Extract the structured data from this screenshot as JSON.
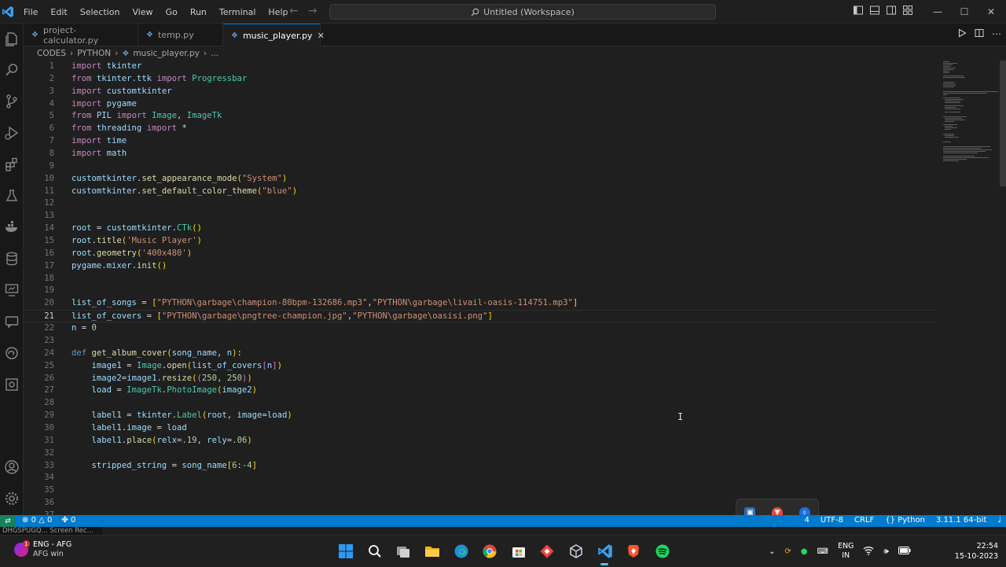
{
  "app": {
    "menu": [
      "File",
      "Edit",
      "Selection",
      "View",
      "Go",
      "Run",
      "Terminal",
      "Help"
    ],
    "search": "Untitled (Workspace)"
  },
  "tabs": [
    {
      "label": "project-calculator.py",
      "active": false
    },
    {
      "label": "temp.py",
      "active": false
    },
    {
      "label": "music_player.py",
      "active": true
    }
  ],
  "breadcrumb": {
    "root": "CODES",
    "folder": "PYTHON",
    "file": "music_player.py",
    "more": "..."
  },
  "editor": {
    "current_line": "21",
    "lines": [
      {
        "n": "1",
        "tokens": [
          [
            "kw",
            "import"
          ],
          [
            "txt",
            " "
          ],
          [
            "var",
            "tkinter"
          ]
        ]
      },
      {
        "n": "2",
        "tokens": [
          [
            "kw",
            "from"
          ],
          [
            "txt",
            " "
          ],
          [
            "var",
            "tkinter.ttk"
          ],
          [
            "txt",
            " "
          ],
          [
            "kw",
            "import"
          ],
          [
            "txt",
            " "
          ],
          [
            "cls",
            "Progressbar"
          ]
        ]
      },
      {
        "n": "3",
        "tokens": [
          [
            "kw",
            "import"
          ],
          [
            "txt",
            " "
          ],
          [
            "var",
            "customtkinter"
          ]
        ]
      },
      {
        "n": "4",
        "tokens": [
          [
            "kw",
            "import"
          ],
          [
            "txt",
            " "
          ],
          [
            "var",
            "pygame"
          ]
        ]
      },
      {
        "n": "5",
        "tokens": [
          [
            "kw",
            "from"
          ],
          [
            "txt",
            " "
          ],
          [
            "var",
            "PIL"
          ],
          [
            "txt",
            " "
          ],
          [
            "kw",
            "import"
          ],
          [
            "txt",
            " "
          ],
          [
            "cls",
            "Image"
          ],
          [
            "txt",
            ", "
          ],
          [
            "cls",
            "ImageTk"
          ]
        ]
      },
      {
        "n": "6",
        "tokens": [
          [
            "kw",
            "from"
          ],
          [
            "txt",
            " "
          ],
          [
            "var",
            "threading"
          ],
          [
            "txt",
            " "
          ],
          [
            "kw",
            "import"
          ],
          [
            "txt",
            " *"
          ]
        ]
      },
      {
        "n": "7",
        "tokens": [
          [
            "kw",
            "import"
          ],
          [
            "txt",
            " "
          ],
          [
            "var",
            "time"
          ]
        ]
      },
      {
        "n": "8",
        "tokens": [
          [
            "kw",
            "import"
          ],
          [
            "txt",
            " "
          ],
          [
            "var",
            "math"
          ]
        ]
      },
      {
        "n": "9",
        "tokens": []
      },
      {
        "n": "10",
        "tokens": [
          [
            "var",
            "customtkinter"
          ],
          [
            "txt",
            "."
          ],
          [
            "fn",
            "set_appearance_mode"
          ],
          [
            "br1",
            "("
          ],
          [
            "str",
            "\"System\""
          ],
          [
            "br1",
            ")"
          ]
        ]
      },
      {
        "n": "11",
        "tokens": [
          [
            "var",
            "customtkinter"
          ],
          [
            "txt",
            "."
          ],
          [
            "fn",
            "set_default_color_theme"
          ],
          [
            "br1",
            "("
          ],
          [
            "str",
            "\"blue\""
          ],
          [
            "br1",
            ")"
          ]
        ]
      },
      {
        "n": "12",
        "tokens": []
      },
      {
        "n": "13",
        "tokens": []
      },
      {
        "n": "14",
        "tokens": [
          [
            "var",
            "root"
          ],
          [
            "txt",
            " = "
          ],
          [
            "var",
            "customtkinter"
          ],
          [
            "txt",
            "."
          ],
          [
            "cls",
            "CTk"
          ],
          [
            "br1",
            "()"
          ]
        ]
      },
      {
        "n": "15",
        "tokens": [
          [
            "var",
            "root"
          ],
          [
            "txt",
            "."
          ],
          [
            "fn",
            "title"
          ],
          [
            "br1",
            "("
          ],
          [
            "str",
            "'Music Player'"
          ],
          [
            "br1",
            ")"
          ]
        ]
      },
      {
        "n": "16",
        "tokens": [
          [
            "var",
            "root"
          ],
          [
            "txt",
            "."
          ],
          [
            "fn",
            "geometry"
          ],
          [
            "br1",
            "("
          ],
          [
            "str",
            "'400x480'"
          ],
          [
            "br1",
            ")"
          ]
        ]
      },
      {
        "n": "17",
        "tokens": [
          [
            "var",
            "pygame"
          ],
          [
            "txt",
            "."
          ],
          [
            "var",
            "mixer"
          ],
          [
            "txt",
            "."
          ],
          [
            "fn",
            "init"
          ],
          [
            "br1",
            "()"
          ]
        ]
      },
      {
        "n": "18",
        "tokens": []
      },
      {
        "n": "19",
        "tokens": []
      },
      {
        "n": "20",
        "tokens": [
          [
            "var",
            "list_of_songs"
          ],
          [
            "txt",
            " = "
          ],
          [
            "br1",
            "["
          ],
          [
            "str",
            "\"PYTHON\\garbage\\champion-80bpm-132686.mp3\""
          ],
          [
            "txt",
            ","
          ],
          [
            "str",
            "\"PYTHON\\garbage\\livail-oasis-114751.mp3\""
          ],
          [
            "br1",
            "]"
          ]
        ]
      },
      {
        "n": "21",
        "tokens": [
          [
            "var",
            "list_of_covers"
          ],
          [
            "txt",
            " = "
          ],
          [
            "br1",
            "["
          ],
          [
            "str",
            "\"PYTHON\\garbage\\pngtree-champion.jpg\""
          ],
          [
            "txt",
            ","
          ],
          [
            "str",
            "\"PYTHON\\garbage\\oasisi.png\""
          ],
          [
            "br1",
            "]"
          ]
        ]
      },
      {
        "n": "22",
        "tokens": [
          [
            "var",
            "n"
          ],
          [
            "txt",
            " = "
          ],
          [
            "num",
            "0"
          ]
        ]
      },
      {
        "n": "23",
        "tokens": []
      },
      {
        "n": "24",
        "tokens": [
          [
            "def",
            "def"
          ],
          [
            "txt",
            " "
          ],
          [
            "fn",
            "get_album_cover"
          ],
          [
            "br1",
            "("
          ],
          [
            "var",
            "song_name"
          ],
          [
            "txt",
            ", "
          ],
          [
            "var",
            "n"
          ],
          [
            "br1",
            ")"
          ],
          [
            "txt",
            ":"
          ]
        ]
      },
      {
        "n": "25",
        "tokens": [
          [
            "txt",
            "    "
          ],
          [
            "var",
            "image1"
          ],
          [
            "txt",
            " = "
          ],
          [
            "cls",
            "Image"
          ],
          [
            "txt",
            "."
          ],
          [
            "fn",
            "open"
          ],
          [
            "br1",
            "("
          ],
          [
            "var",
            "list_of_covers"
          ],
          [
            "br2",
            "["
          ],
          [
            "var",
            "n"
          ],
          [
            "br2",
            "]"
          ],
          [
            "br1",
            ")"
          ]
        ]
      },
      {
        "n": "26",
        "tokens": [
          [
            "txt",
            "    "
          ],
          [
            "var",
            "image2"
          ],
          [
            "txt",
            "="
          ],
          [
            "var",
            "image1"
          ],
          [
            "txt",
            "."
          ],
          [
            "fn",
            "resize"
          ],
          [
            "br1",
            "("
          ],
          [
            "br2",
            "("
          ],
          [
            "num",
            "250"
          ],
          [
            "txt",
            ", "
          ],
          [
            "num",
            "250"
          ],
          [
            "br2",
            ")"
          ],
          [
            "br1",
            ")"
          ]
        ]
      },
      {
        "n": "27",
        "tokens": [
          [
            "txt",
            "    "
          ],
          [
            "var",
            "load"
          ],
          [
            "txt",
            " = "
          ],
          [
            "cls",
            "ImageTk"
          ],
          [
            "txt",
            "."
          ],
          [
            "cls",
            "PhotoImage"
          ],
          [
            "br1",
            "("
          ],
          [
            "var",
            "image2"
          ],
          [
            "br1",
            ")"
          ]
        ]
      },
      {
        "n": "28",
        "tokens": []
      },
      {
        "n": "29",
        "tokens": [
          [
            "txt",
            "    "
          ],
          [
            "var",
            "label1"
          ],
          [
            "txt",
            " = "
          ],
          [
            "var",
            "tkinter"
          ],
          [
            "txt",
            "."
          ],
          [
            "cls",
            "Label"
          ],
          [
            "br1",
            "("
          ],
          [
            "var",
            "root"
          ],
          [
            "txt",
            ", "
          ],
          [
            "var",
            "image"
          ],
          [
            "txt",
            "="
          ],
          [
            "var",
            "load"
          ],
          [
            "br1",
            ")"
          ]
        ]
      },
      {
        "n": "30",
        "tokens": [
          [
            "txt",
            "    "
          ],
          [
            "var",
            "label1"
          ],
          [
            "txt",
            "."
          ],
          [
            "var",
            "image"
          ],
          [
            "txt",
            " = "
          ],
          [
            "var",
            "load"
          ]
        ]
      },
      {
        "n": "31",
        "tokens": [
          [
            "txt",
            "    "
          ],
          [
            "var",
            "label1"
          ],
          [
            "txt",
            "."
          ],
          [
            "fn",
            "place"
          ],
          [
            "br1",
            "("
          ],
          [
            "var",
            "relx"
          ],
          [
            "txt",
            "="
          ],
          [
            "num",
            ".19"
          ],
          [
            "txt",
            ", "
          ],
          [
            "var",
            "rely"
          ],
          [
            "txt",
            "="
          ],
          [
            "num",
            ".06"
          ],
          [
            "br1",
            ")"
          ]
        ]
      },
      {
        "n": "32",
        "tokens": []
      },
      {
        "n": "33",
        "tokens": [
          [
            "txt",
            "    "
          ],
          [
            "var",
            "stripped_string"
          ],
          [
            "txt",
            " = "
          ],
          [
            "var",
            "song_name"
          ],
          [
            "br1",
            "["
          ],
          [
            "num",
            "6"
          ],
          [
            "txt",
            ":"
          ],
          [
            "num",
            "-4"
          ],
          [
            "br1",
            "]"
          ]
        ]
      },
      {
        "n": "34",
        "tokens": []
      },
      {
        "n": "35",
        "tokens": []
      },
      {
        "n": "36",
        "tokens": []
      },
      {
        "n": "37",
        "tokens": []
      }
    ]
  },
  "status": {
    "errors": "0",
    "warnings": "0",
    "ports": "0",
    "right_items": [
      "4",
      "UTF-8",
      "CRLF",
      "Python",
      "3.11.1 64-bit"
    ]
  },
  "tooltip_strip": "DHGSPUGQ... Screen Rec...",
  "taskbar": {
    "kb_badge": "1",
    "kb_line1": "ENG - AFG",
    "kb_line2": "AFG win",
    "lang_line1": "ENG",
    "lang_line2": "IN",
    "time": "22:54",
    "date": "15-10-2023"
  },
  "colors": {
    "accent": "#007acc",
    "remote": "#16825d",
    "keyword": "#c586c0",
    "string": "#ce9178"
  }
}
